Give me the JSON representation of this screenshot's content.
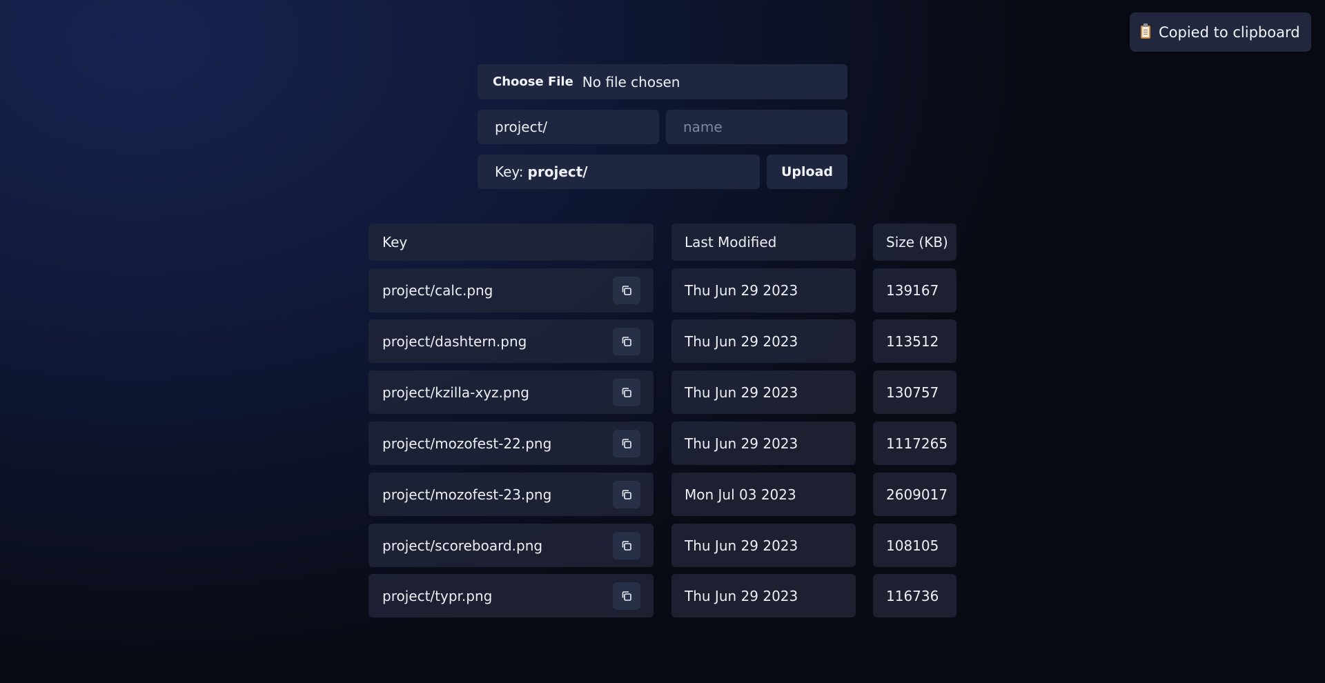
{
  "toast": {
    "message": "Copied to clipboard",
    "icon": "clipboard-icon"
  },
  "upload": {
    "choose_file_label": "Choose File",
    "file_status": "No file chosen",
    "prefix_value": "project/",
    "name_placeholder": "name",
    "key_label": "Key:",
    "key_value": "project/",
    "upload_label": "Upload"
  },
  "table": {
    "headers": [
      "Key",
      "Last Modified",
      "Size (KB)"
    ],
    "rows": [
      {
        "key": "project/calc.png",
        "modified": "Thu Jun 29 2023",
        "size": "139167"
      },
      {
        "key": "project/dashtern.png",
        "modified": "Thu Jun 29 2023",
        "size": "113512"
      },
      {
        "key": "project/kzilla-xyz.png",
        "modified": "Thu Jun 29 2023",
        "size": "130757"
      },
      {
        "key": "project/mozofest-22.png",
        "modified": "Thu Jun 29 2023",
        "size": "1117265"
      },
      {
        "key": "project/mozofest-23.png",
        "modified": "Mon Jul 03 2023",
        "size": "2609017"
      },
      {
        "key": "project/scoreboard.png",
        "modified": "Thu Jun 29 2023",
        "size": "108105"
      },
      {
        "key": "project/typr.png",
        "modified": "Thu Jun 29 2023",
        "size": "116736"
      }
    ],
    "copy_icon": "copy-icon"
  }
}
